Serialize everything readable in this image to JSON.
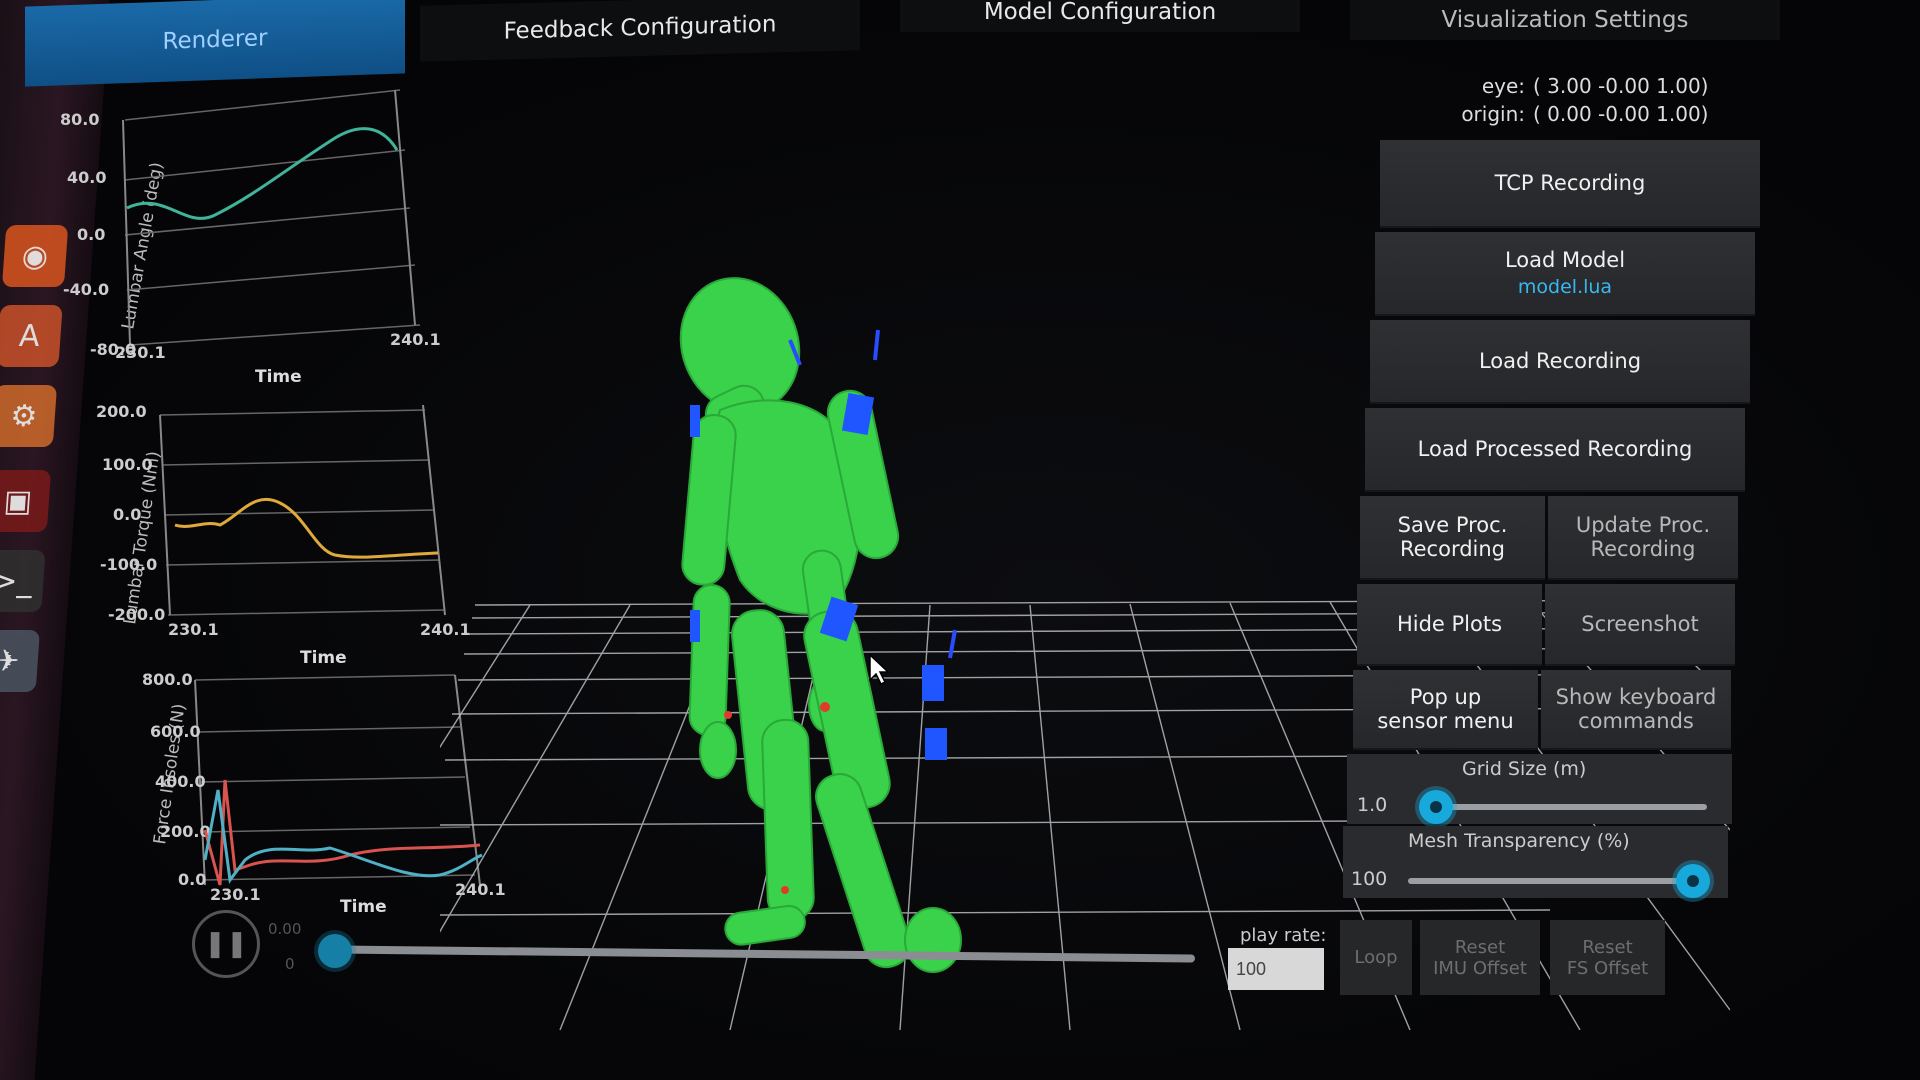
{
  "tabs": {
    "renderer": "Renderer",
    "feedback": "Feedback Configuration",
    "model": "Model Configuration",
    "visualization": "Visualization Settings"
  },
  "plots": [
    {
      "ylabel": "Lumbar Angle (deg)",
      "xlabel": "Time",
      "yticks": [
        "80.0",
        "40.0",
        "0.0",
        "-40.0",
        "-80.0"
      ],
      "xmin": "230.1",
      "xmax": "240.1",
      "color": "#3fb49a"
    },
    {
      "ylabel": "Lumbar Torque (Nm)",
      "xlabel": "Time",
      "yticks": [
        "200.0",
        "100.0",
        "0.0",
        "-100.0",
        "-200.0"
      ],
      "xmin": "230.1",
      "xmax": "240.1",
      "color": "#e0a93a"
    },
    {
      "ylabel": "Force Insoles (N)",
      "xlabel": "Time",
      "yticks": [
        "800.0",
        "600.0",
        "400.0",
        "200.0",
        "0.0"
      ],
      "xmin": "230.1",
      "xmax": "240.1",
      "colors": [
        "#d9534f",
        "#4fb0c6"
      ]
    }
  ],
  "camera": {
    "eye_label": "eye:",
    "eye_value": "( 3.00 -0.00  1.00)",
    "origin_label": "origin:",
    "origin_value": "( 0.00 -0.00  1.00)"
  },
  "buttons": {
    "tcp_recording": "TCP Recording",
    "load_model": "Load Model",
    "load_model_file": "model.lua",
    "load_recording": "Load Recording",
    "load_processed": "Load Processed Recording",
    "save_proc_line1": "Save Proc.",
    "save_proc_line2": "Recording",
    "update_proc_line1": "Update Proc.",
    "update_proc_line2": "Recording",
    "hide_plots": "Hide Plots",
    "screenshot": "Screenshot",
    "popup_line1": "Pop up",
    "popup_line2": "sensor menu",
    "keyboard_line1": "Show keyboard",
    "keyboard_line2": "commands"
  },
  "sliders": {
    "grid_label": "Grid Size (m)",
    "grid_value": "1.0",
    "grid_level": 0.05,
    "mesh_label": "Mesh Transparency (%)",
    "mesh_value": "100",
    "mesh_level": 1.0
  },
  "playback": {
    "time_top": "0.00",
    "time_bottom": "0",
    "progress": 0.0,
    "play_rate_label": "play rate:",
    "play_rate_value": "100",
    "loop": "Loop",
    "reset_imu_line1": "Reset",
    "reset_imu_line2": "IMU Offset",
    "reset_fs_line1": "Reset",
    "reset_fs_line2": "FS Offset"
  },
  "icons": {
    "play_pause": "pause-icon",
    "launcher": [
      "firefox-icon",
      "font-icon",
      "settings-icon",
      "photo-icon",
      "terminal-icon",
      "app-icon"
    ]
  }
}
